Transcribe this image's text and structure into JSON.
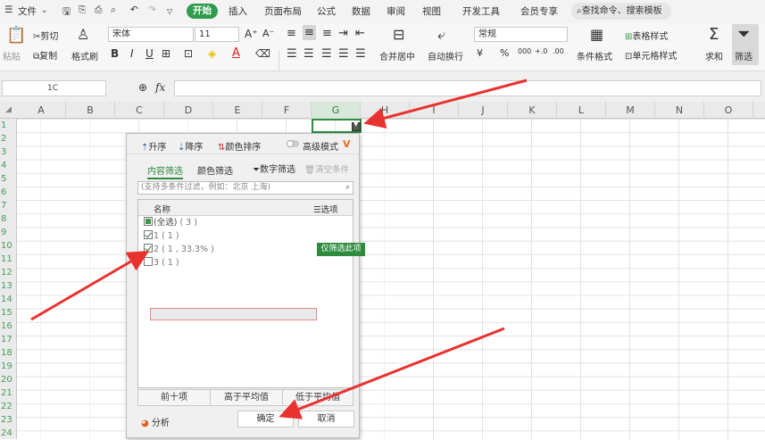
{
  "menubar": {
    "menu_label": "文件",
    "tabs": [
      "开始",
      "插入",
      "页面布局",
      "公式",
      "数据",
      "审阅",
      "视图",
      "开发工具",
      "会员专享"
    ],
    "search": "查找命令、搜索模板"
  },
  "ribbon": {
    "paste": "粘贴",
    "cut": "剪切",
    "copy": "复制",
    "format_painter": "格式刷",
    "font_name": "宋体",
    "font_size": "11",
    "number_format": "常规",
    "merge_center": "合并居中",
    "wrap_text": "自动换行",
    "conditional_format": "条件格式",
    "table_style": "表格样式",
    "cell_style": "单元格样式",
    "sum": "求和",
    "filter": "筛选",
    "currency": "¥",
    "percent": "%",
    "thousand": "000",
    "inc_dec": "+.0",
    "dec_dec": ".00"
  },
  "formula_bar": {
    "name_box": "1C",
    "fx": "fx"
  },
  "columns": [
    "A",
    "B",
    "C",
    "D",
    "E",
    "F",
    "G",
    "H",
    "I",
    "J",
    "K",
    "L",
    "M",
    "N",
    "O"
  ],
  "rows": [
    "1",
    "2",
    "3",
    "4",
    "5",
    "6",
    "7",
    "8",
    "9",
    "10",
    "11",
    "12",
    "13",
    "14",
    "15",
    "16",
    "17",
    "18",
    "19",
    "20",
    "21",
    "22",
    "23",
    "24"
  ],
  "filter_panel": {
    "sort_asc": "升序",
    "sort_desc": "降序",
    "sort_color": "颜色排序",
    "advanced": "高级模式",
    "tab_content": "内容筛选",
    "tab_color": "颜色筛选",
    "number_filter": "数字筛选",
    "clear": "清空条件",
    "search_placeholder": "(支持多条件过滤，例如：北京 上海)",
    "list_header": "名称",
    "options": "选项",
    "items": [
      {
        "label": "(全选)",
        "count": "( 3 )",
        "state": "partial"
      },
      {
        "label": "1",
        "count": "( 1 )",
        "state": "checked"
      },
      {
        "label": "2",
        "count": "( 1 , 33.3% )",
        "state": "checked"
      },
      {
        "label": "3",
        "count": "( 1 )",
        "state": "unchecked"
      }
    ],
    "only_filter": "仅筛选此项",
    "top10": "前十项",
    "above_avg": "高于平均值",
    "below_avg": "低于平均值",
    "analysis": "分析",
    "ok": "确定",
    "cancel": "取消"
  },
  "colors": {
    "accent": "#2e9c4a",
    "arrow": "#e8322f"
  }
}
